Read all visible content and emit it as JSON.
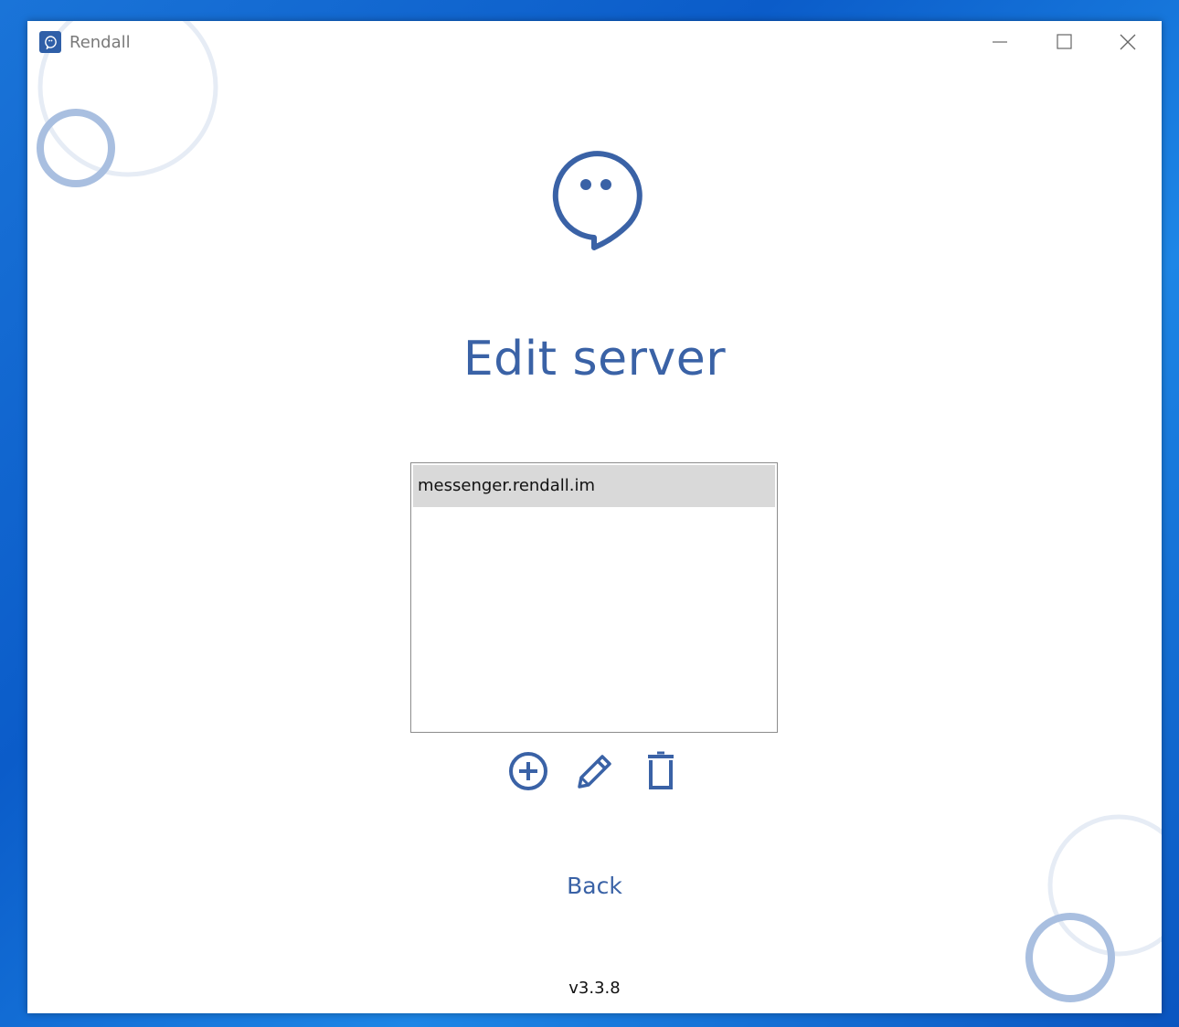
{
  "window": {
    "title": "Rendall",
    "controls": [
      "minimize",
      "maximize",
      "close"
    ]
  },
  "logo": {
    "icon": "chat-bubble-logo-icon"
  },
  "page": {
    "heading": "Edit server"
  },
  "server_list": {
    "items": [
      "messenger.rendall.im"
    ],
    "selected_index": 0
  },
  "toolbar": {
    "add_icon": "plus-circle-icon",
    "edit_icon": "pencil-icon",
    "delete_icon": "trash-icon"
  },
  "back_label": "Back",
  "version": "v3.3.8",
  "colors": {
    "accent": "#3a62a6",
    "decor_ring": "#a9bfe0",
    "decor_ring_light": "#e4ebf5",
    "selected_row": "#d9d9d9"
  }
}
